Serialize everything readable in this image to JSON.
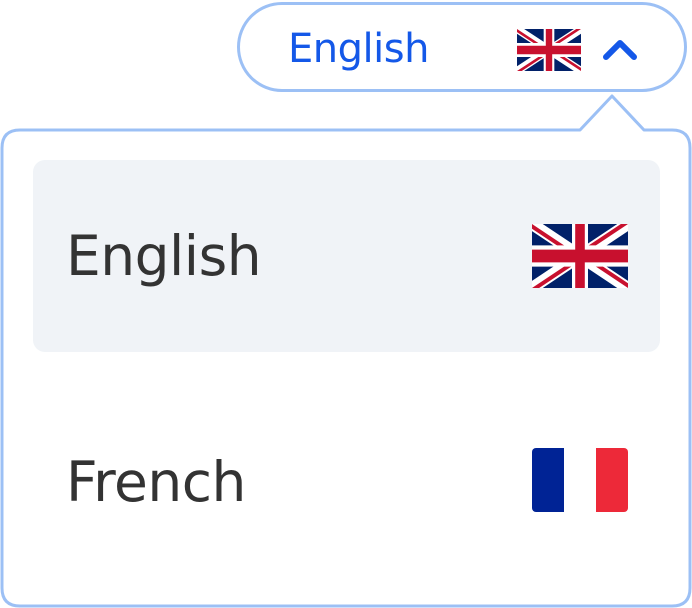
{
  "selector": {
    "label": "English",
    "flag_icon": "uk-flag-icon",
    "chevron_icon": "chevron-up-icon",
    "expanded": true
  },
  "menu": {
    "options": [
      {
        "label": "English",
        "flag_icon": "uk-flag-icon",
        "selected": true
      },
      {
        "label": "French",
        "flag_icon": "france-flag-icon",
        "selected": false
      }
    ]
  },
  "colors": {
    "accent": "#1458e8",
    "border": "#9cc0f5",
    "selected_bg": "#f0f3f7",
    "text": "#333333",
    "uk_blue": "#012169",
    "uk_red": "#c8102e",
    "fr_blue": "#002395",
    "fr_red": "#ed2939"
  }
}
